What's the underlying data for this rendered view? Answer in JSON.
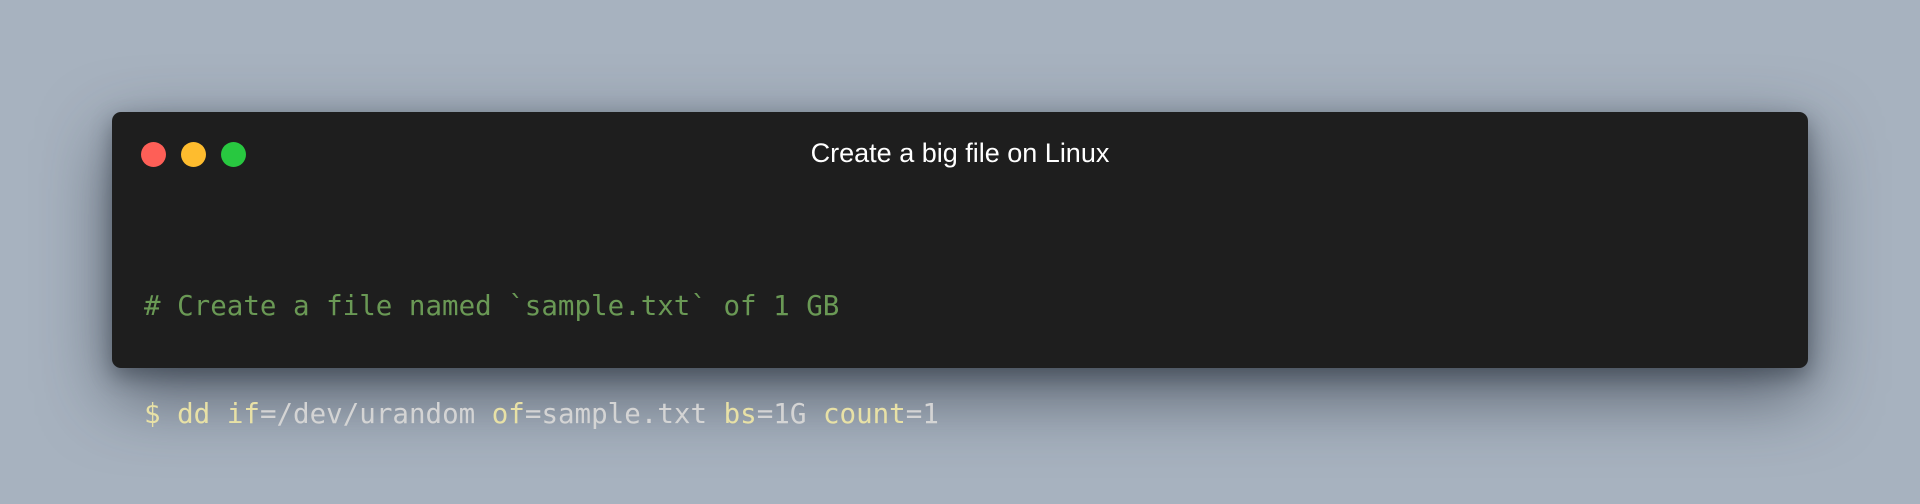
{
  "window": {
    "title": "Create a big file on Linux",
    "controls": [
      "close",
      "minimize",
      "maximize"
    ]
  },
  "code": {
    "comment": "# Create a file named `sample.txt` of 1 GB",
    "prompt": "$",
    "command": "dd",
    "args": [
      {
        "key": "if",
        "sep": "=",
        "value": "/dev/urandom"
      },
      {
        "key": "of",
        "sep": "=",
        "value": "sample.txt"
      },
      {
        "key": "bs",
        "sep": "=",
        "value": "1G"
      },
      {
        "key": "count",
        "sep": "=",
        "value": "1"
      }
    ]
  },
  "colors": {
    "background": "#a7b2bf",
    "window": "#1e1e1e",
    "close": "#fe5f57",
    "minimize": "#febc2e",
    "maximize": "#28c840",
    "comment": "#6a9955",
    "keyword": "#e8e1a6",
    "text": "#d4d4d4"
  }
}
